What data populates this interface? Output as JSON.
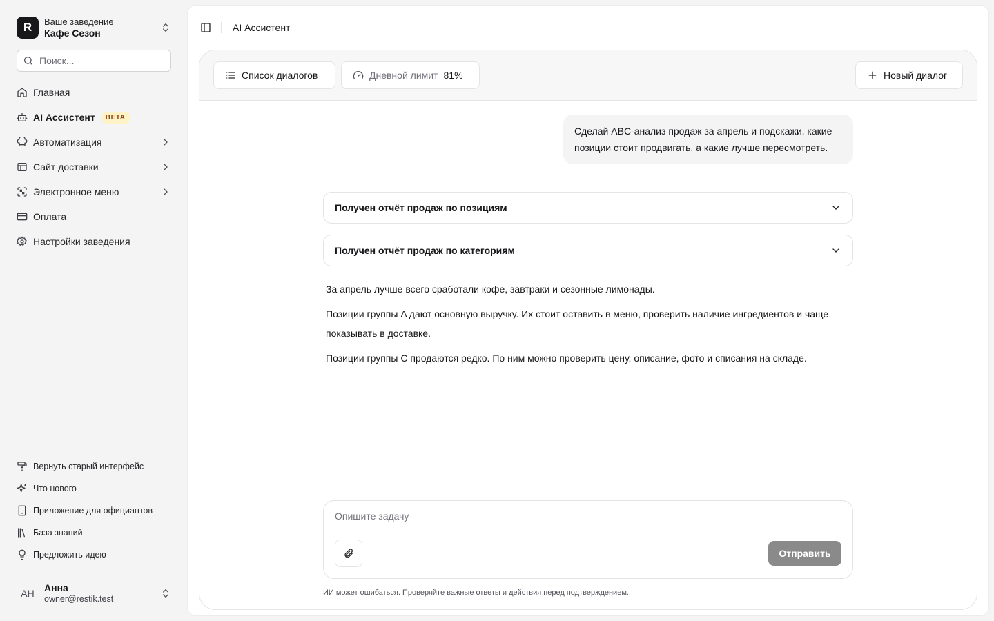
{
  "venue": {
    "subtitle": "Ваше заведение",
    "name": "Кафе Сезон",
    "logo_letter": "R"
  },
  "search": {
    "placeholder": "Поиск..."
  },
  "nav": [
    {
      "label": "Главная",
      "icon": "home-icon"
    },
    {
      "label": "AI Ассистент",
      "icon": "bot-icon",
      "badge": "BETA",
      "active": true
    },
    {
      "label": "Автоматизация",
      "icon": "chef-hat-icon",
      "chevron": true
    },
    {
      "label": "Сайт доставки",
      "icon": "browser-icon",
      "chevron": true
    },
    {
      "label": "Электронное меню",
      "icon": "qr-scan-icon",
      "chevron": true
    },
    {
      "label": "Оплата",
      "icon": "credit-card-icon"
    },
    {
      "label": "Настройки заведения",
      "icon": "gear-icon"
    }
  ],
  "bottom_nav": [
    {
      "label": "Вернуть старый интерфейс",
      "icon": "paint-roller-icon"
    },
    {
      "label": "Что нового",
      "icon": "sparkles-icon"
    },
    {
      "label": "Приложение для официантов",
      "icon": "tablet-icon"
    },
    {
      "label": "База знаний",
      "icon": "library-icon"
    },
    {
      "label": "Предложить идею",
      "icon": "lightbulb-icon"
    }
  ],
  "user": {
    "initials": "АН",
    "name": "Анна",
    "email": "owner@restik.test"
  },
  "breadcrumb": "AI Ассистент",
  "chat": {
    "list_button": "Список диалогов",
    "limit_label": "Дневной лимит",
    "limit_value": "81%",
    "new_button": "Новый диалог",
    "user_message": "Сделай ABC-анализ продаж за апрель и подскажи, какие позиции стоит продвигать, а какие лучше пересмотреть.",
    "tools": [
      "Получен отчёт продаж по позициям",
      "Получен отчёт продаж по категориям"
    ],
    "answer": [
      "За апрель лучше всего сработали кофе, завтраки и сезонные лимонады.",
      "Позиции группы A дают основную выручку. Их стоит оставить в меню, проверить наличие ингредиентов и чаще показывать в доставке.",
      "Позиции группы C продаются редко. По ним можно проверить цену, описание, фото и списания на складе."
    ],
    "composer_placeholder": "Опишите задачу",
    "send_button": "Отправить",
    "disclaimer": "ИИ может ошибаться. Проверяйте важные ответы и действия перед подтверждением."
  }
}
